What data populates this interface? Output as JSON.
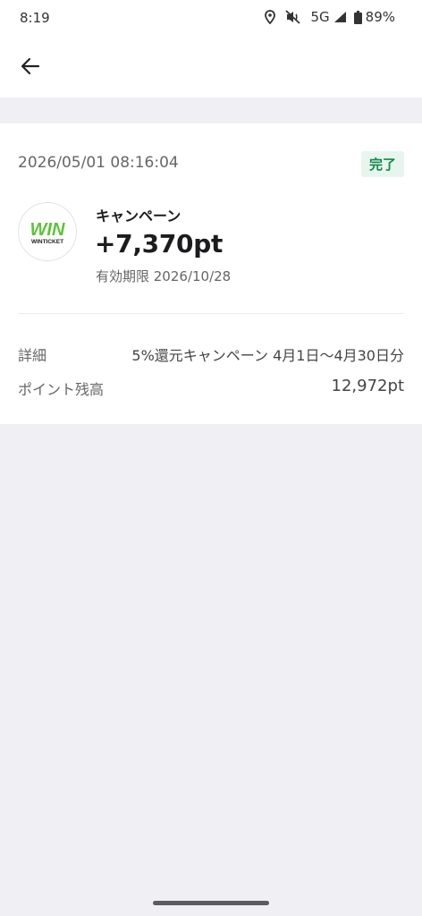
{
  "status_bar": {
    "time": "8:19",
    "network": "5G",
    "battery": "89%",
    "icons": [
      "location-icon",
      "mute-icon",
      "signal-icon",
      "battery-icon"
    ]
  },
  "app_bar": {
    "back_icon": "arrow-left-icon"
  },
  "transaction": {
    "datetime": "2026/05/01 08:16:04",
    "status": "完了",
    "logo_text": "WINTICKET",
    "name": "キャンペーン",
    "amount": "+7,370pt",
    "expiry": "有効期限 2026/10/28"
  },
  "details": [
    {
      "label": "詳細",
      "value": "5%還元キャンペーン 4月1日〜4月30日分"
    },
    {
      "label": "ポイント残高",
      "value": "12,972pt"
    }
  ],
  "colors": {
    "accent_green": "#0f8a4a",
    "badge_bg": "#e8f5ee",
    "logo_green": "#5cc43a",
    "page_bg": "#efeff4"
  }
}
